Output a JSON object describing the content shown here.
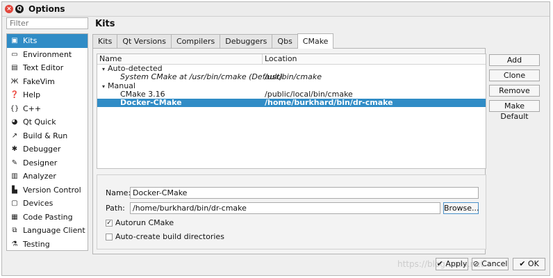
{
  "window": {
    "title": "Options"
  },
  "filter": {
    "placeholder": "Filter"
  },
  "sidebar": {
    "items": [
      {
        "label": "Kits",
        "icon": "monitor-icon",
        "glyph": "▣",
        "selected": true
      },
      {
        "label": "Environment",
        "icon": "display-icon",
        "glyph": "▭",
        "selected": false
      },
      {
        "label": "Text Editor",
        "icon": "text-editor-icon",
        "glyph": "▤",
        "selected": false
      },
      {
        "label": "FakeVim",
        "icon": "fakevim-icon",
        "glyph": "Ж",
        "selected": false
      },
      {
        "label": "Help",
        "icon": "help-icon",
        "glyph": "❓",
        "selected": false
      },
      {
        "label": "C++",
        "icon": "braces-icon",
        "glyph": "{}",
        "selected": false
      },
      {
        "label": "Qt Quick",
        "icon": "qt-quick-icon",
        "glyph": "◕",
        "selected": false
      },
      {
        "label": "Build & Run",
        "icon": "hammer-icon",
        "glyph": "↗",
        "selected": false
      },
      {
        "label": "Debugger",
        "icon": "bug-icon",
        "glyph": "✱",
        "selected": false
      },
      {
        "label": "Designer",
        "icon": "pencil-icon",
        "glyph": "✎",
        "selected": false
      },
      {
        "label": "Analyzer",
        "icon": "analyzer-icon",
        "glyph": "▥",
        "selected": false
      },
      {
        "label": "Version Control",
        "icon": "version-control-icon",
        "glyph": "▙",
        "selected": false
      },
      {
        "label": "Devices",
        "icon": "devices-icon",
        "glyph": "▢",
        "selected": false
      },
      {
        "label": "Code Pasting",
        "icon": "code-pasting-icon",
        "glyph": "▦",
        "selected": false
      },
      {
        "label": "Language Client",
        "icon": "language-client-icon",
        "glyph": "⧉",
        "selected": false
      },
      {
        "label": "Testing",
        "icon": "testing-icon",
        "glyph": "⚗",
        "selected": false
      }
    ]
  },
  "main": {
    "title": "Kits",
    "tabs": [
      {
        "label": "Kits",
        "active": false
      },
      {
        "label": "Qt Versions",
        "active": false
      },
      {
        "label": "Compilers",
        "active": false
      },
      {
        "label": "Debuggers",
        "active": false
      },
      {
        "label": "Qbs",
        "active": false
      },
      {
        "label": "CMake",
        "active": true
      }
    ],
    "tree": {
      "headers": {
        "name": "Name",
        "location": "Location"
      },
      "rows": [
        {
          "name": "Auto-detected",
          "location": "",
          "level": 0,
          "expanded": true
        },
        {
          "name": "System CMake at /usr/bin/cmake (Default)",
          "location": "/usr/bin/cmake",
          "level": 1,
          "italic": true
        },
        {
          "name": "Manual",
          "location": "",
          "level": 0,
          "expanded": true
        },
        {
          "name": "CMake 3.16",
          "location": "/public/local/bin/cmake",
          "level": 1
        },
        {
          "name": "Docker-CMake",
          "location": "/home/burkhard/bin/dr-cmake",
          "level": 1,
          "selected": true
        }
      ]
    },
    "buttons": {
      "add": "Add",
      "clone": "Clone",
      "remove": "Remove",
      "make_default": "Make Default"
    },
    "details": {
      "name_label": "Name:",
      "name_value": "Docker-CMake",
      "path_label": "Path:",
      "path_value": "/home/burkhard/bin/dr-cmake",
      "browse": "Browse...",
      "autorun_label": "Autorun CMake",
      "autorun_checked": true,
      "autocreate_label": "Auto-create build directories",
      "autocreate_checked": false
    }
  },
  "footer": {
    "apply": "Apply",
    "cancel": "Cancel",
    "ok": "OK"
  },
  "watermark": "https://blog.csdn.net",
  "colors": {
    "selection": "#308cc6",
    "close": "#e2473d"
  }
}
